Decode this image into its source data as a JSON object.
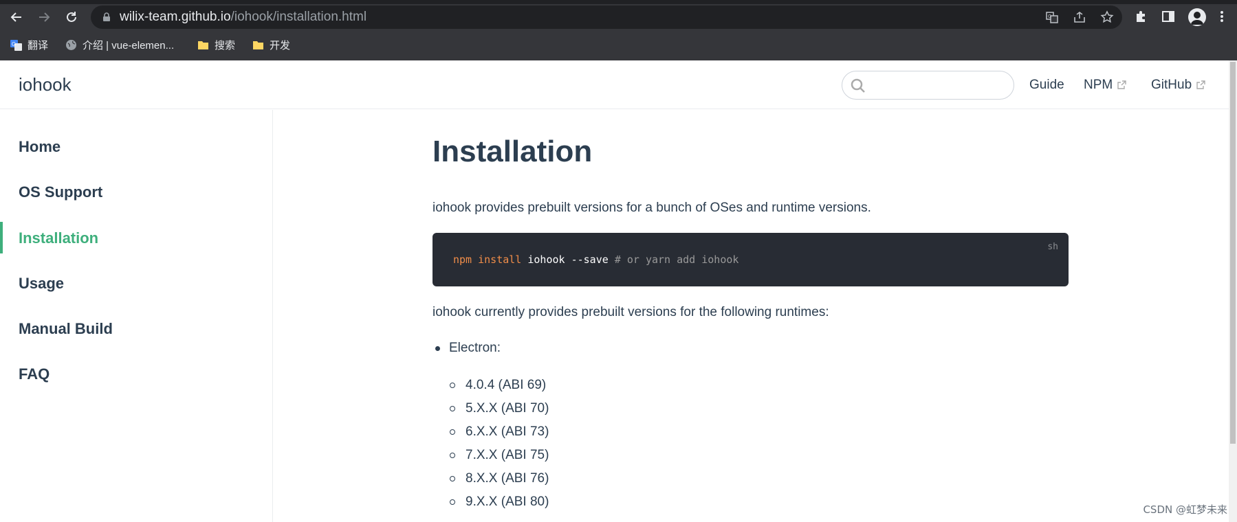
{
  "browser": {
    "url_host": "wilix-team.github.io",
    "url_path": "/iohook/installation.html",
    "bookmarks": [
      {
        "label": "翻译",
        "icon": "translate-icon"
      },
      {
        "label": "介绍 | vue-elemen...",
        "icon": "globe-icon"
      },
      {
        "label": "搜索",
        "icon": "folder-icon"
      },
      {
        "label": "开发",
        "icon": "folder-icon"
      }
    ]
  },
  "site": {
    "name": "iohook",
    "search_placeholder": "",
    "nav": {
      "guide": "Guide",
      "npm": "NPM",
      "github": "GitHub"
    }
  },
  "sidebar": {
    "items": [
      {
        "label": "Home"
      },
      {
        "label": "OS Support"
      },
      {
        "label": "Installation",
        "active": true
      },
      {
        "label": "Usage"
      },
      {
        "label": "Manual Build"
      },
      {
        "label": "FAQ"
      }
    ]
  },
  "content": {
    "title": "Installation",
    "intro": "iohook provides prebuilt versions for a bunch of OSes and runtime versions.",
    "code": {
      "lang": "sh",
      "cmd1": "npm",
      "cmd2": "install",
      "arg1": "iohook",
      "arg2": "--save",
      "comment": "# or yarn add iohook"
    },
    "runtimes_intro": "iohook currently provides prebuilt versions for the following runtimes:",
    "runtime_name": "Electron:",
    "versions": [
      "4.0.4 (ABI 69)",
      "5.X.X (ABI 70)",
      "6.X.X (ABI 73)",
      "7.X.X (ABI 75)",
      "8.X.X (ABI 76)",
      "9.X.X (ABI 80)"
    ]
  },
  "watermark": "CSDN @虹梦未来",
  "colors": {
    "accent": "#3eaf7c",
    "text": "#2c3e50",
    "code_bg": "#282c34",
    "chrome_bg": "#35363a"
  }
}
